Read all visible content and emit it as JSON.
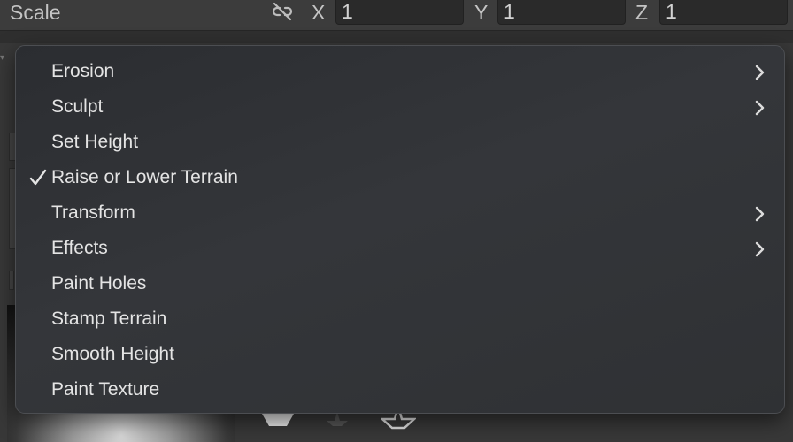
{
  "inspector": {
    "scale_label": "Scale",
    "x_label": "X",
    "y_label": "Y",
    "z_label": "Z",
    "x_value": "1",
    "y_value": "1",
    "z_value": "1"
  },
  "menu": {
    "checked_item": "Raise or Lower Terrain",
    "items": [
      {
        "label": "Erosion",
        "has_submenu": true,
        "checked": false
      },
      {
        "label": "Sculpt",
        "has_submenu": true,
        "checked": false
      },
      {
        "label": "Set Height",
        "has_submenu": false,
        "checked": false
      },
      {
        "label": "Raise or Lower Terrain",
        "has_submenu": false,
        "checked": true
      },
      {
        "label": "Transform",
        "has_submenu": true,
        "checked": false
      },
      {
        "label": "Effects",
        "has_submenu": true,
        "checked": false
      },
      {
        "label": "Paint Holes",
        "has_submenu": false,
        "checked": false
      },
      {
        "label": "Stamp Terrain",
        "has_submenu": false,
        "checked": false
      },
      {
        "label": "Smooth Height",
        "has_submenu": false,
        "checked": false
      },
      {
        "label": "Paint Texture",
        "has_submenu": false,
        "checked": false
      }
    ]
  },
  "icons": {
    "link": "unlinked-chain-icon",
    "check": "checkmark-icon",
    "submenu": "chevron-right-icon"
  },
  "colors": {
    "menu_text": "#e4e4e4",
    "panel_bg": "#383838",
    "field_bg": "#2a2a2a"
  }
}
